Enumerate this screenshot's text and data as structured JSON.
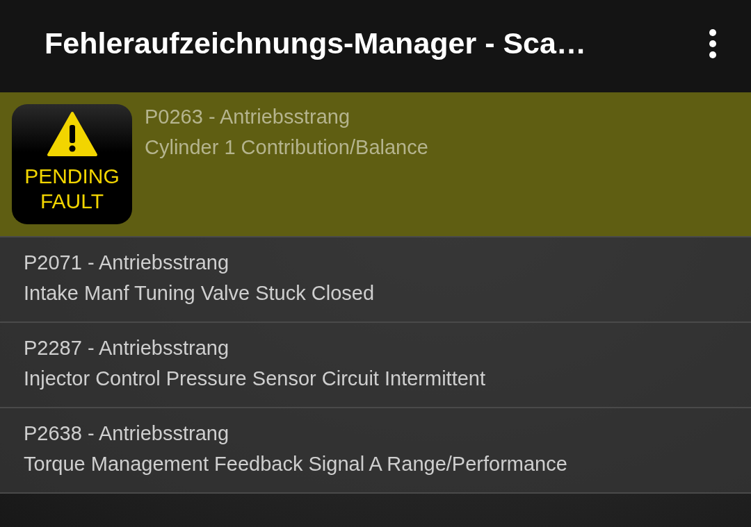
{
  "app_bar": {
    "title": "Fehleraufzeichnungs-Manager - Sca…"
  },
  "faults": [
    {
      "kind": "pending",
      "badge": [
        "PENDING",
        "FAULT"
      ],
      "code": "P0263 - Antriebsstrang",
      "description": "Cylinder 1 Contribution/Balance"
    },
    {
      "kind": "normal",
      "code": "P2071 - Antriebsstrang",
      "description": "Intake Manf Tuning Valve Stuck Closed"
    },
    {
      "kind": "normal",
      "code": "P2287 - Antriebsstrang",
      "description": "Injector Control Pressure Sensor Circuit Intermittent"
    },
    {
      "kind": "normal",
      "code": "P2638 - Antriebsstrang",
      "description": "Torque Management Feedback Signal A Range/Performance"
    }
  ]
}
